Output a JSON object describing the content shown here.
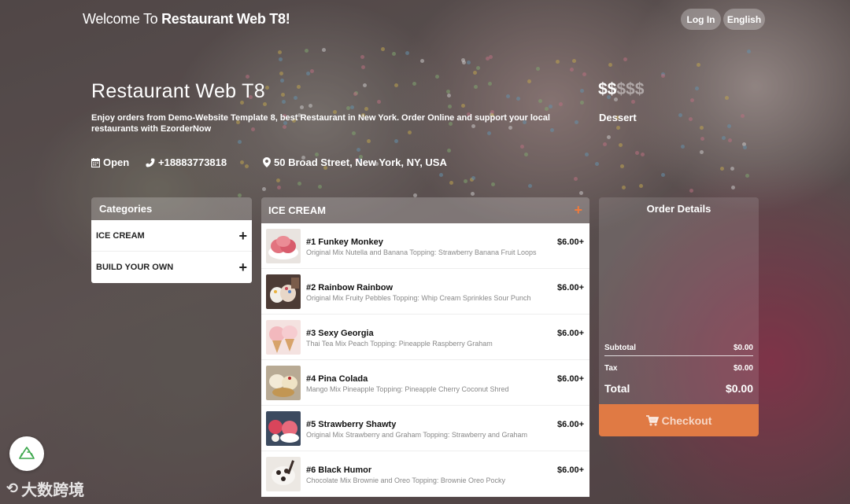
{
  "header": {
    "welcome_prefix": "Welcome To",
    "restaurant_name_bold": "Restaurant Web T8!",
    "login_label": "Log In",
    "language_label": "English"
  },
  "hero": {
    "title": "Restaurant Web T8",
    "description": "Enjoy orders from Demo-Website Template 8, best Restaurant in New York. Order Online and support your local restaurants with EzorderNow",
    "price_active": "$$",
    "price_inactive": "$$$",
    "cuisine": "Dessert",
    "status": "Open",
    "phone": "+18883773818",
    "address": "50 Broad Street, New York, NY, USA"
  },
  "categories": {
    "title": "Categories",
    "items": [
      {
        "label": "ICE CREAM"
      },
      {
        "label": "BUILD YOUR OWN"
      }
    ]
  },
  "menu": {
    "section_title": "ICE CREAM",
    "items": [
      {
        "name": "#1 Funkey Monkey",
        "desc": "Original Mix Nutella and Banana Topping: Strawberry Banana Fruit Loops",
        "price": "$6.00+"
      },
      {
        "name": "#2 Rainbow Rainbow",
        "desc": "Original Mix Fruity Pebbles Topping: Whip Cream Sprinkles Sour Punch",
        "price": "$6.00+"
      },
      {
        "name": "#3 Sexy Georgia",
        "desc": "Thai Tea Mix Peach Topping: Pineapple Raspberry Graham",
        "price": "$6.00+"
      },
      {
        "name": "#4 Pina Colada",
        "desc": "Mango Mix Pineapple Topping: Pineapple Cherry Coconut Shred",
        "price": "$6.00+"
      },
      {
        "name": "#5 Strawberry Shawty",
        "desc": "Original Mix Strawberry and Graham Topping: Strawberry and Graham",
        "price": "$6.00+"
      },
      {
        "name": "#6 Black Humor",
        "desc": "Chocolate Mix Brownie and Oreo Topping: Brownie Oreo Pocky",
        "price": "$6.00+"
      }
    ]
  },
  "order": {
    "title": "Order Details",
    "subtotal_label": "Subtotal",
    "subtotal_value": "$0.00",
    "tax_label": "Tax",
    "tax_value": "$0.00",
    "total_label": "Total",
    "total_value": "$0.00",
    "checkout_label": "Checkout"
  },
  "watermark": {
    "text": "大数跨境"
  },
  "colors": {
    "accent": "#e07a44",
    "plus_accent": "#f07a3c"
  }
}
